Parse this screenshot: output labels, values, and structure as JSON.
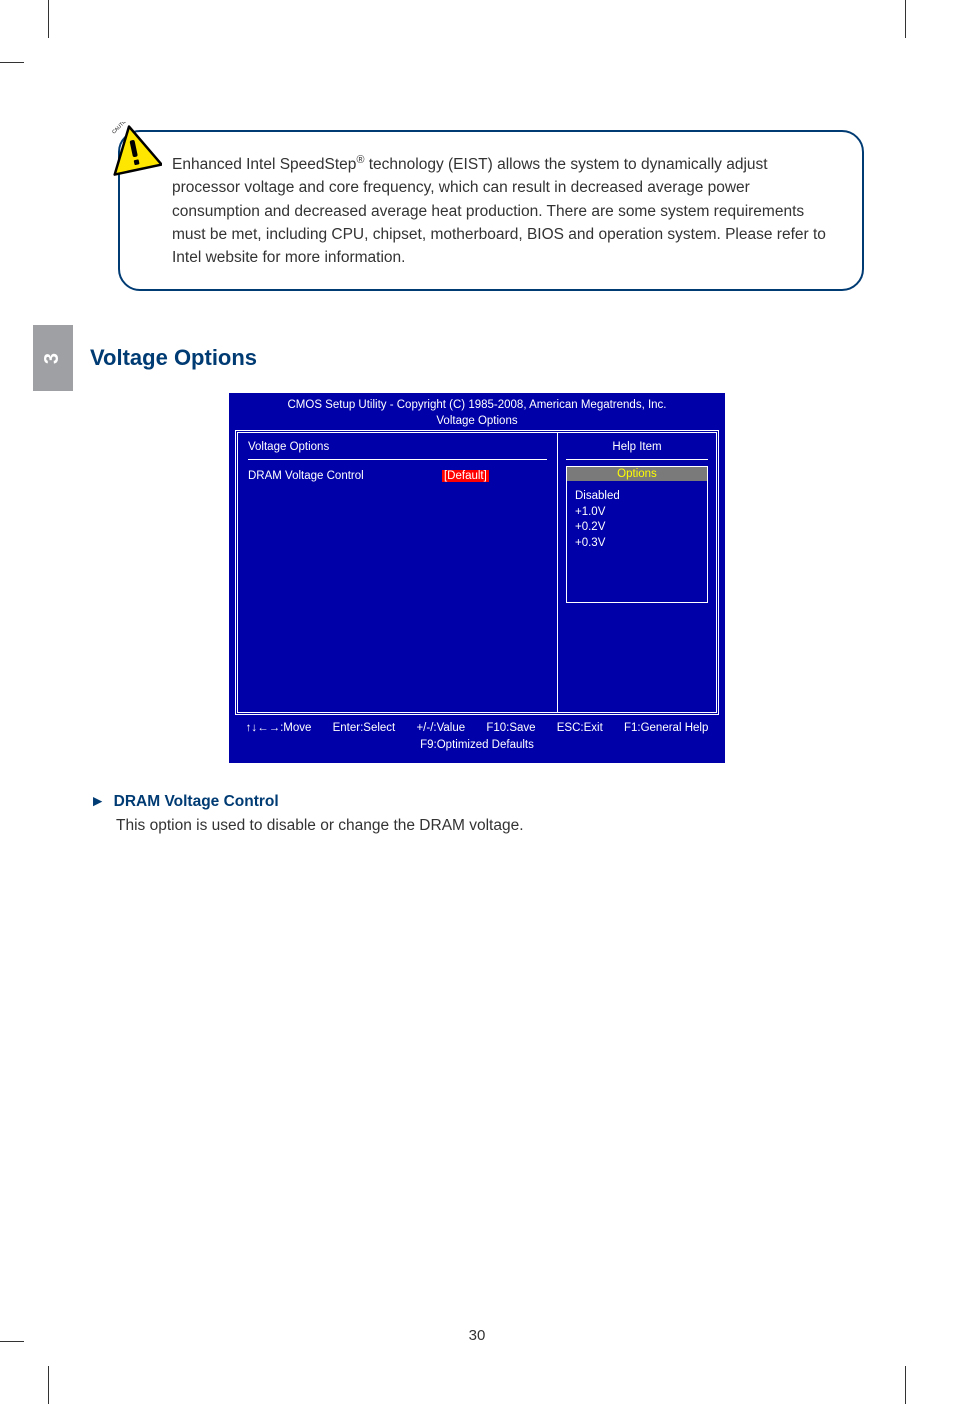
{
  "chapter_number": "3",
  "caution": {
    "label": "CAUTION",
    "text_pre": "Enhanced Intel SpeedStep",
    "reg": "®",
    "text_post": " technology (EIST) allows the system to dynamically adjust processor voltage and core frequency, which can result in decreased average power consumption and decreased average heat production.  There are some system requirements must be met, including CPU, chipset, motherboard, BIOS and operation system. Please refer to Intel website for more information."
  },
  "section_heading": "Voltage Options",
  "bios": {
    "title_line1": "CMOS Setup Utility - Copyright (C) 1985-2008, American Megatrends, Inc.",
    "title_line2": "Voltage Options",
    "left_header": "Voltage Options",
    "setting_label": "DRAM Voltage Control",
    "setting_value": "[Default]",
    "help_header": "Help Item",
    "options_title": "Options",
    "options": [
      "Disabled",
      "+1.0V",
      "+0.2V",
      "+0.3V"
    ],
    "footer": {
      "move": "↑↓←→:Move",
      "select": "Enter:Select",
      "value": "+/-/:Value",
      "save": "F10:Save",
      "exit": "ESC:Exit",
      "help": "F1:General Help",
      "defaults": "F9:Optimized Defaults"
    }
  },
  "item": {
    "arrow": "►",
    "heading": "DRAM Voltage Control",
    "desc": "This option is used to disable or change the DRAM voltage."
  },
  "page_number": "30"
}
